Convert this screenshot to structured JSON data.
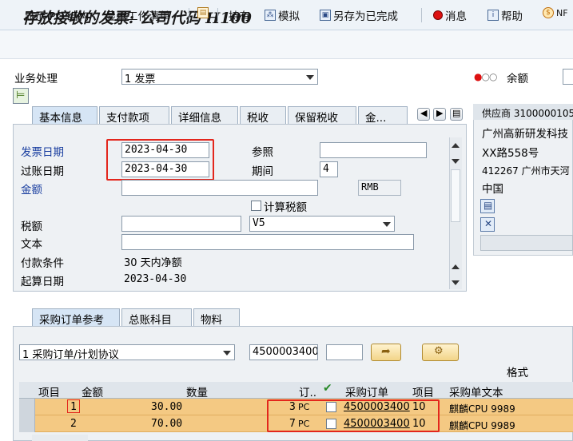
{
  "title": "存放接收的发票: 公司代码 H100",
  "toolbar": {
    "items": [
      "显示 PO 结构",
      "显示工作清单",
      "持有",
      "模拟",
      "另存为已完成",
      "消息",
      "帮助",
      "NF"
    ]
  },
  "transaction": {
    "label": "业务处理",
    "value": "1 发票"
  },
  "balance": {
    "label": "余额"
  },
  "header_tabs": [
    "基本信息",
    "支付款项",
    "详细信息",
    "税收",
    "保留税收",
    "金..."
  ],
  "form": {
    "invoice_date_label": "发票日期",
    "invoice_date": "2023-04-30",
    "posting_date_label": "过账日期",
    "posting_date": "2023-04-30",
    "reference_label": "参照",
    "reference": "",
    "period_label": "期间",
    "period": "4",
    "amount_label": "金额",
    "amount": "",
    "currency": "RMB",
    "calc_tax_label": "计算税额",
    "tax_label": "税额",
    "tax_amount": "",
    "tax_code": "V5",
    "text_label": "文本",
    "text": "",
    "payment_terms_label": "付款条件",
    "payment_terms": "30 天内净额",
    "baseline_label": "起算日期",
    "baseline_date": "2023-04-30"
  },
  "vendor": {
    "header": "供应商 3100000105",
    "name": "广州高新研发科技",
    "street": "XX路558号",
    "city": "412267 广州市天河",
    "country": "中国"
  },
  "item_tabs": [
    "采购订单参考",
    "总账科目",
    "物料"
  ],
  "po_ref": {
    "type": "1 采购订单/计划协议",
    "po_number": "4500003400",
    "item": "",
    "layout_label": "格式"
  },
  "grid": {
    "headers": [
      "项目",
      "金额",
      "数量",
      "订..",
      "",
      "采购订单",
      "项目",
      "采购单文本"
    ],
    "rows": [
      {
        "item": "1",
        "amount": "30.00",
        "qty": "",
        "ord_qty": "3",
        "unit": "PC",
        "po": "4500003400",
        "po_item": "10",
        "text": "麒麟CPU 9989"
      },
      {
        "item": "2",
        "amount": "70.00",
        "qty": "",
        "ord_qty": "7",
        "unit": "PC",
        "po": "4500003400",
        "po_item": "10",
        "text": "麒麟CPU 9989"
      }
    ]
  }
}
